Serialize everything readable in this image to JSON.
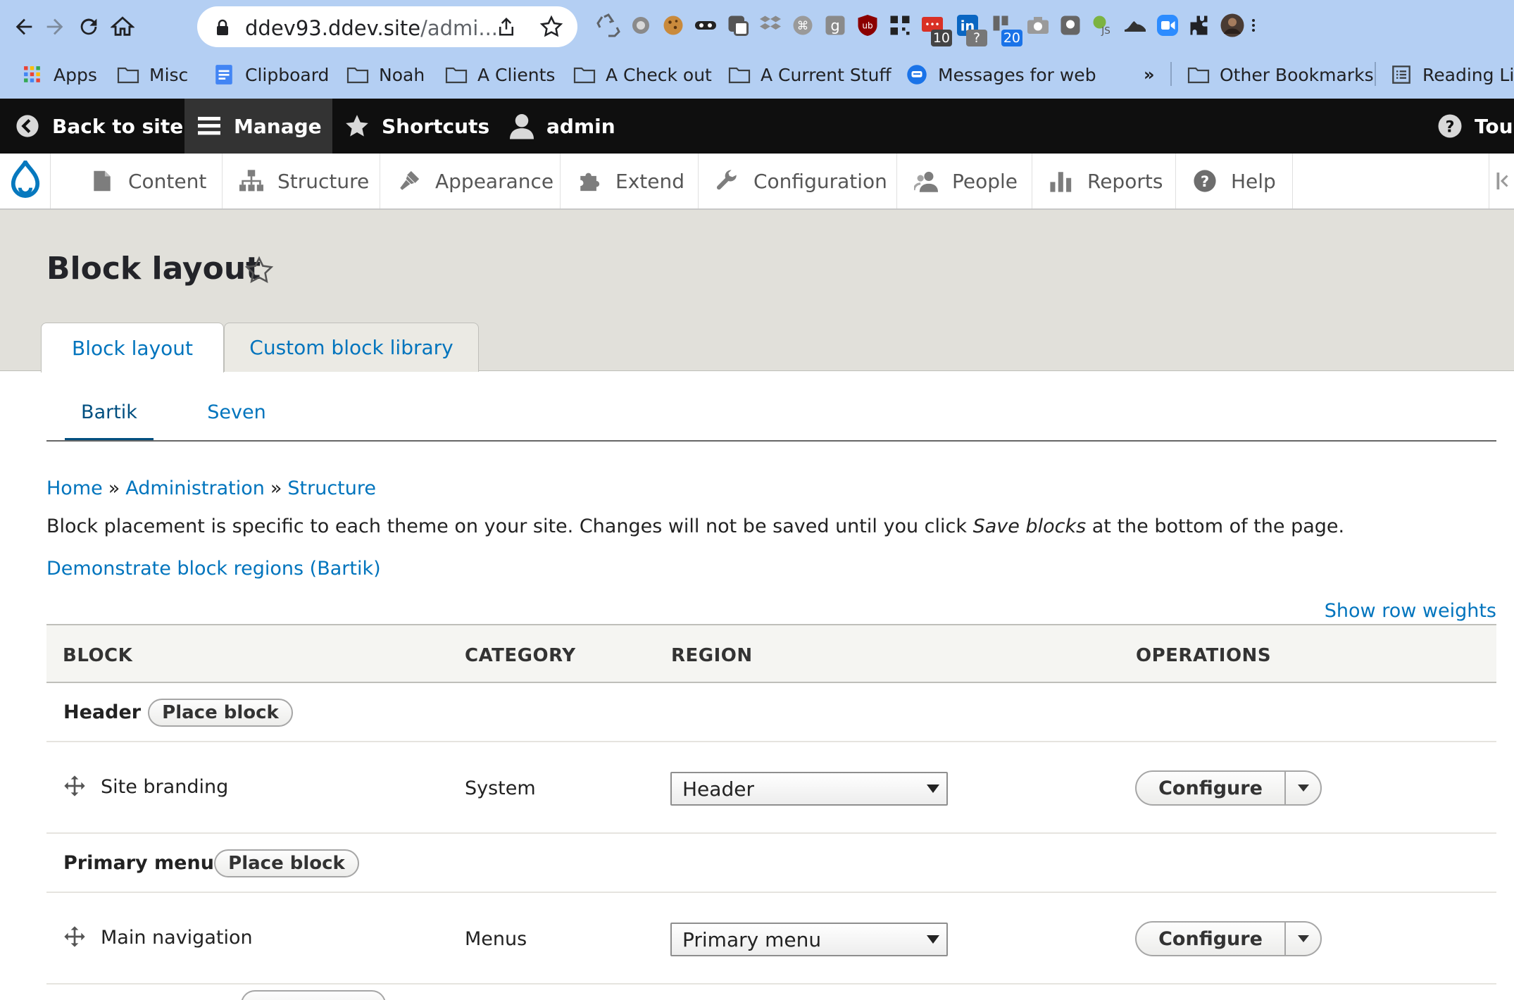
{
  "browser": {
    "url_host": "ddev93.ddev.site",
    "url_path": "/admi...",
    "extension_badges": {
      "mail": "10",
      "linkedin": "?",
      "trello": "20"
    }
  },
  "bookmarks": {
    "items": [
      {
        "label": "Apps",
        "icon": "apps-grid-icon"
      },
      {
        "label": "Misc",
        "icon": "folder-icon"
      },
      {
        "label": "Clipboard",
        "icon": "docs-icon"
      },
      {
        "label": "Noah",
        "icon": "folder-icon"
      },
      {
        "label": "A Clients",
        "icon": "folder-icon"
      },
      {
        "label": "A Check out",
        "icon": "folder-icon"
      },
      {
        "label": "A Current Stuff",
        "icon": "folder-icon"
      },
      {
        "label": "Messages for web",
        "icon": "messages-icon"
      }
    ],
    "overflow": "»",
    "other": "Other Bookmarks",
    "reading_list": "Reading Lis"
  },
  "toolbar": {
    "back_to_site": "Back to site",
    "manage": "Manage",
    "shortcuts": "Shortcuts",
    "user": "admin",
    "tour": "Tour"
  },
  "tray": {
    "items": [
      "Content",
      "Structure",
      "Appearance",
      "Extend",
      "Configuration",
      "People",
      "Reports",
      "Help"
    ]
  },
  "page": {
    "title": "Block layout",
    "primary_tabs": [
      "Block layout",
      "Custom block library"
    ],
    "secondary_tabs": [
      "Bartik",
      "Seven"
    ]
  },
  "breadcrumb": {
    "items": [
      "Home",
      "Administration",
      "Structure"
    ],
    "separator": "»"
  },
  "content": {
    "help_before": "Block placement is specific to each theme on your site. Changes will not be saved until you click ",
    "help_em": "Save blocks",
    "help_after": " at the bottom of the page.",
    "demo_link": "Demonstrate block regions (Bartik)",
    "show_row_weights": "Show row weights"
  },
  "table": {
    "headers": [
      "BLOCK",
      "CATEGORY",
      "REGION",
      "OPERATIONS"
    ],
    "regions": [
      {
        "name": "Header",
        "place_label": "Place block",
        "blocks": [
          {
            "name": "Site branding",
            "category": "System",
            "region": "Header",
            "operation": "Configure"
          }
        ]
      },
      {
        "name": "Primary menu",
        "place_label": "Place block",
        "blocks": [
          {
            "name": "Main navigation",
            "category": "Menus",
            "region": "Primary menu",
            "operation": "Configure"
          }
        ]
      }
    ]
  },
  "colors": {
    "chrome_bar": "#b4cff3",
    "toolbar_black": "#0f0f0f",
    "link_blue": "#0074bd",
    "header_bg": "#e1e0da",
    "drupal_blue": "#0678be"
  }
}
